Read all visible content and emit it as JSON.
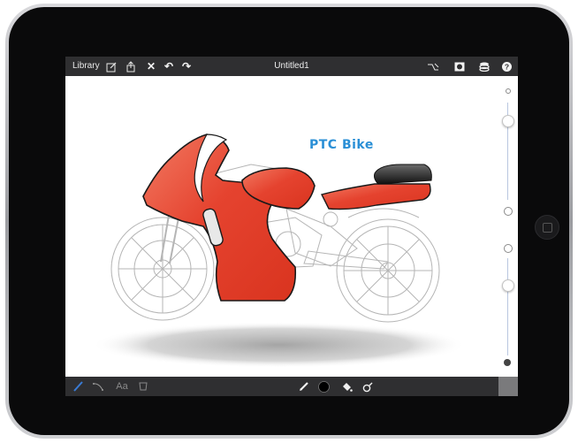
{
  "toolbar": {
    "library_label": "Library",
    "document_title": "Untitled1"
  },
  "canvas": {
    "drawing_text": "PTC Bike"
  },
  "bottombar": {
    "text_tool_label": "Aa"
  },
  "colors": {
    "toolbar_bg": "#2f2f31",
    "fairing_red": "#e5432f",
    "title_blue": "#2a8fd6",
    "active_tool_blue": "#3a7bd5"
  },
  "icons": {
    "top_left": [
      "edit-icon",
      "share-icon",
      "close-icon",
      "undo-icon",
      "redo-icon"
    ],
    "top_right": [
      "symmetry-icon",
      "canvas-icon",
      "layers-icon",
      "help-icon"
    ],
    "bottom_left": [
      "pencil-active-icon",
      "curve-tool-icon",
      "text-tool-icon",
      "transform-icon"
    ],
    "bottom_center": [
      "pencil-icon",
      "color-dot-icon",
      "fill-icon",
      "eraser-icon"
    ]
  }
}
